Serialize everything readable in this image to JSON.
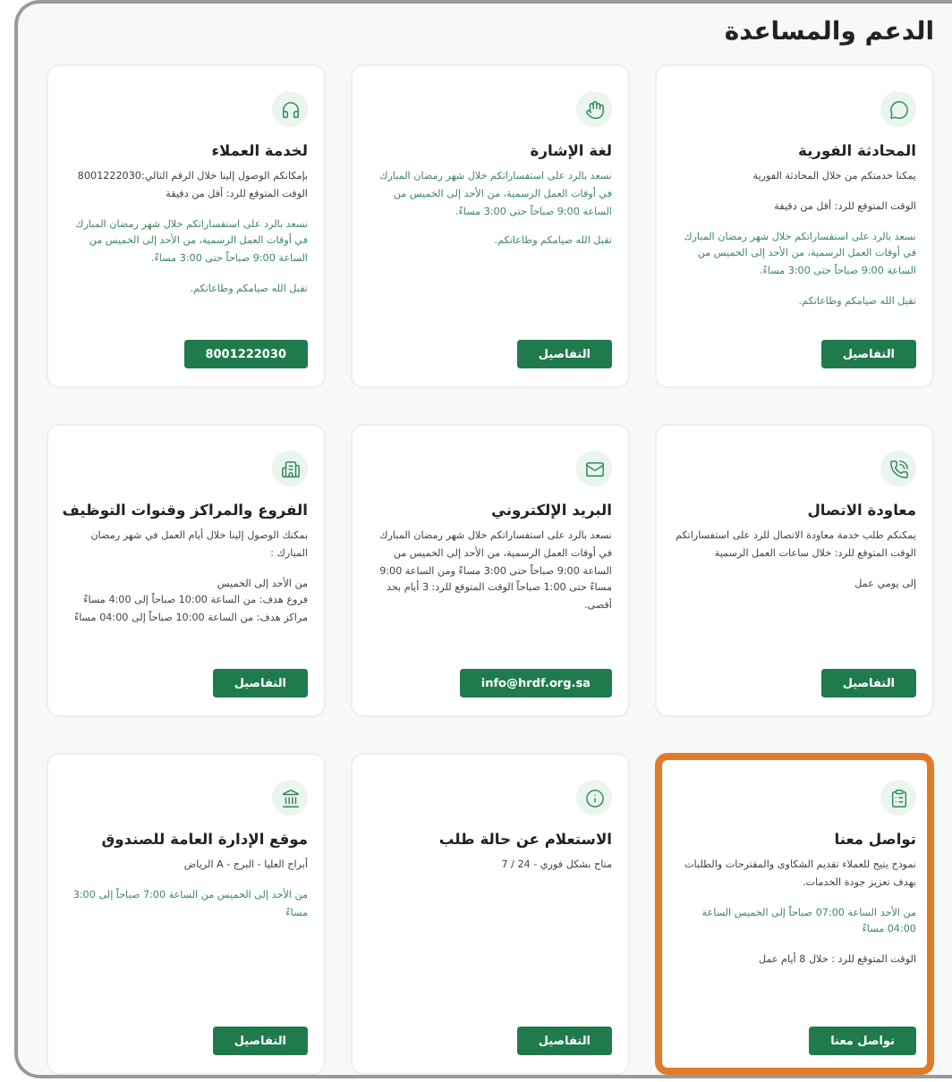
{
  "title": "الدعم والمساعدة",
  "cards": [
    {
      "title": "المحادثة الفورية",
      "highlighted": false,
      "paragraphs": [
        {
          "color": "#444444",
          "lines": [
            "يمكنا خدمتكم من خلال المحادثة الفورية"
          ]
        },
        {
          "color": "#444444",
          "lines": [
            "الوقت المتوقع للرد: أقل من دقيقة"
          ]
        },
        {
          "color": "#3e8a5f",
          "lines": [
            "نسعد بالرد على استفساراتكم خلال شهر رمضان المبارك في أوقات العمل الرسمية، من الأحد إلى الخميس من الساعة 9:00 صباحاً حتى 3:00 مساءً."
          ]
        },
        {
          "color": "#3e8a5f",
          "lines": [
            "تقبل الله صيامكم وطاعاتكم."
          ]
        }
      ],
      "button": "التفاصيل"
    },
    {
      "title": "لغة الإشارة",
      "highlighted": false,
      "paragraphs": [
        {
          "color": "#3e8a5f",
          "lines": [
            "نسعد بالرد على استفساراتكم خلال شهر رمضان المبارك في أوقات العمل الرسمية، من الأحد إلى الخميس من الساعة 9:00 صباحاً حتى 3:00 مساءً."
          ]
        },
        {
          "color": "#3e8a5f",
          "lines": [
            "تقبل الله صيامكم وطاعاتكم."
          ]
        }
      ],
      "button": "التفاصيل"
    },
    {
      "title": "لخدمة العملاء",
      "highlighted": false,
      "paragraphs": [
        {
          "color": "#444444",
          "lines": [
            "بإمكانكم الوصول إلينا خلال الرقم التالي:8001222030",
            "الوقت المتوقع للرد: أقل من دقيقة"
          ]
        },
        {
          "color": "#3e8a5f",
          "lines": [
            "نسعد بالرد على استفساراتكم خلال شهر رمضان المبارك في أوقات العمل الرسمية، من الأحد إلى الخميس من الساعة 9:00 صباحاً حتى 3:00 مساءً."
          ]
        },
        {
          "color": "#3e8a5f",
          "lines": [
            "تقبل الله صيامكم وطاعاتكم."
          ]
        }
      ],
      "button": "8001222030"
    },
    {
      "title": "معاودة الاتصال",
      "highlighted": false,
      "paragraphs": [
        {
          "color": "#444444",
          "lines": [
            "يمكنكم طلب خدمة معاودة الاتصال للرد على استفساراتكم الوقت المتوقع للرد: خلال ساعات العمل الرسمية"
          ]
        },
        {
          "color": "#444444",
          "lines": [
            "إلى يومي عمل"
          ]
        }
      ],
      "button": "التفاصيل"
    },
    {
      "title": "البريد الإلكتروني",
      "highlighted": false,
      "paragraphs": [
        {
          "color": "#444444",
          "lines": [
            "نسعد بالرد على استفساراتكم خلال شهر رمضان المبارك في أوقات العمل الرسمية، من الأحد إلى الخميس من الساعة 9:00 صباحاً حتى 3:00 مساءً ومن الساعة 9:00 مساءً حتى 1:00 صباحاً الوقت المتوقع للرد: 3 أيام بحد أقصى."
          ]
        }
      ],
      "button": "info@hrdf.org.sa"
    },
    {
      "title": "الفروع والمراكز وقنوات التوظيف",
      "highlighted": false,
      "paragraphs": [
        {
          "color": "#444444",
          "lines": [
            "بمكنك الوصول إلينا خلال أيام العمل في شهر رمضان المبارك :"
          ]
        },
        {
          "color": "#444444",
          "lines": [
            "من الأحد إلى الخميس",
            "فروع هدف: من الساعة 10:00 صباحاً إلى 4:00 مساءً",
            "مراكز هدف: من الساعة 10:00 صباحاً إلى 04:00 مساءً"
          ]
        }
      ],
      "button": "التفاصيل"
    },
    {
      "title": "تواصل معنا",
      "highlighted": true,
      "paragraphs": [
        {
          "color": "#444444",
          "lines": [
            "نموذج يتيح للعملاء تقديم الشكاوى والمقترحات والطلبات بهدف تعزيز جودة الخدمات."
          ]
        },
        {
          "color": "#3e8a5f",
          "lines": [
            "من الأحد الساعة 07:00 صباحاً إلى الخميس الساعة 04:00 مساءً"
          ]
        },
        {
          "color": "#444444",
          "lines": [
            "الوقت المتوقع للرد : خلال 8 أيام عمل"
          ]
        }
      ],
      "button": "تواصل معنا"
    },
    {
      "title": "الاستعلام عن حالة طلب",
      "highlighted": false,
      "paragraphs": [
        {
          "color": "#444444",
          "lines": [
            "متاح بشكل فوري - 24 / 7"
          ]
        }
      ],
      "button": "التفاصيل"
    },
    {
      "title": "موقع الإدارة العامة للصندوق",
      "highlighted": false,
      "paragraphs": [
        {
          "color": "#444444",
          "lines": [
            "أبراج العليا - البرج - A الرياض"
          ]
        },
        {
          "color": "#3e8a5f",
          "lines": [
            "من الأحد إلى الخميس من الساعة 7:00 صباحاً إلى 3:00 مساءً"
          ]
        }
      ],
      "button": "التفاصيل"
    }
  ]
}
